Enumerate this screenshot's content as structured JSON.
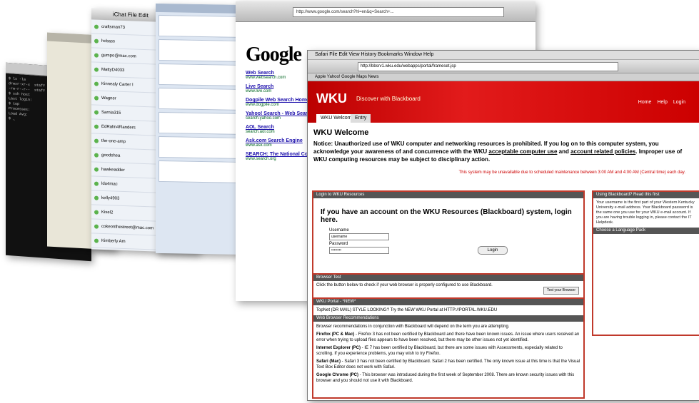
{
  "google": {
    "url": "http://www.google.com/search?hl=en&q=Search+...",
    "logo": "Google",
    "results": [
      {
        "title": "Web Search",
        "url": "www.websearch.com"
      },
      {
        "title": "Live Search",
        "url": "www.live.com"
      },
      {
        "title": "Dogpile Web Search Home Page",
        "url": "www.dogpile.com"
      },
      {
        "title": "Yahoo! Search - Web Search",
        "url": "search.yahoo.com"
      },
      {
        "title": "AOL Search",
        "url": "search.aol.com"
      },
      {
        "title": "Ask.com Search Engine",
        "url": "www.ask.com"
      },
      {
        "title": "SEARCH: The National Consortium",
        "url": "www.search.org"
      }
    ]
  },
  "wku": {
    "menubar": "Safari   File   Edit   View   History   Bookmarks   Window   Help",
    "url": "http://bbsrv1.wku.edu/webapps/portal/frameset.jsp",
    "bookmarks": "Apple   Yahoo!   Google Maps   News",
    "brand": "WKU",
    "brand_sub": "Discover with Blackboard",
    "tab_active": "WKU Welcome",
    "tab_other": "Entry",
    "icons": [
      "Home",
      "Help",
      "Login"
    ],
    "heading": "WKU Welcome",
    "notice_pre": "Notice: Unauthorized use of WKU computer and networking resources is prohibited. If you log on to this computer system, you acknowledge your awareness of and concurrence with the WKU ",
    "notice_link1": "acceptable computer use",
    "notice_mid": " and ",
    "notice_link2": "account related policies",
    "notice_post": ". Improper use of WKU computing resources may be subject to disciplinary action.",
    "maintenance": "This system may be unavailable due to scheduled maintenance between 3:00 AM and 4:00 AM (Central time) each day.",
    "login_panel": {
      "header": "Login to WKU Resources",
      "title": "If you have an account on the WKU Resources (Blackboard) system, login here.",
      "username_label": "Username",
      "username_value": "username",
      "password_label": "Password",
      "password_value": "••••••••",
      "login_button": "Login"
    },
    "browser_test": {
      "header": "Browser Test",
      "text": "Click the button below to check if your web browser is properly configured to use Blackboard.",
      "button": "Test your Browser"
    },
    "portal": {
      "header": "WKU Portal - *NEW*",
      "text": "TopNet (DR MAIL) STYLE LOOKING? Try the NEW WKU Portal at HTTP://PORTAL.WKU.EDU"
    },
    "recommendations": {
      "header": "Web Browser Recommendations",
      "intro": "Browser recommendations in conjunction with Blackboard will depend on the term you are attempting.",
      "items": [
        {
          "name": "Firefox (PC & Mac)",
          "text": "Firefox 3 has not been certified by Blackboard and there have been known issues. An issue where users received an error when trying to upload files appears to have been resolved, but there may be other issues not yet identified."
        },
        {
          "name": "Internet Explorer (PC)",
          "text": "IE 7 has been certified by Blackboard, but there are some issues with Assessments, especially related to scrolling. If you experience problems, you may wish to try Firefox."
        },
        {
          "name": "Safari (Mac)",
          "text": "Safari 3 has not been certified by Blackboard. Safari 2 has been certified. The only known issue at this time is that the Visual Text Box Editor does not work with Safari."
        },
        {
          "name": "Google Chrome (PC)",
          "text": "This browser was introduced during the first week of September 2008. There are known security issues with this browser and you should not use it with Blackboard."
        }
      ]
    },
    "side_panel": {
      "header": "Using Blackboard? Read this first",
      "text": "Your username is the first part of your Western Kentucky University e-mail address. Your Blackboard password is the same one you use for your WKU e-mail account. If you are having trouble logging in, please contact the IT Helpdesk.",
      "lang_header": "Choose a Language Pack"
    }
  },
  "buddy": {
    "title": "iChat   File   Edit",
    "rows": [
      "craftsman73",
      "hcbass",
      "gumpo@mac.com",
      "MattyD4033",
      "Kinnealy Carter I",
      "Wagner",
      "Sarnia315",
      "EdRalin4Flanders",
      "the-one-amp",
      "goodshea",
      "hawkeadder",
      "ldu4mac",
      "kelly4903",
      "Kisel2",
      "cokeonthestreet@mac.com",
      "Kimberly Am"
    ]
  }
}
